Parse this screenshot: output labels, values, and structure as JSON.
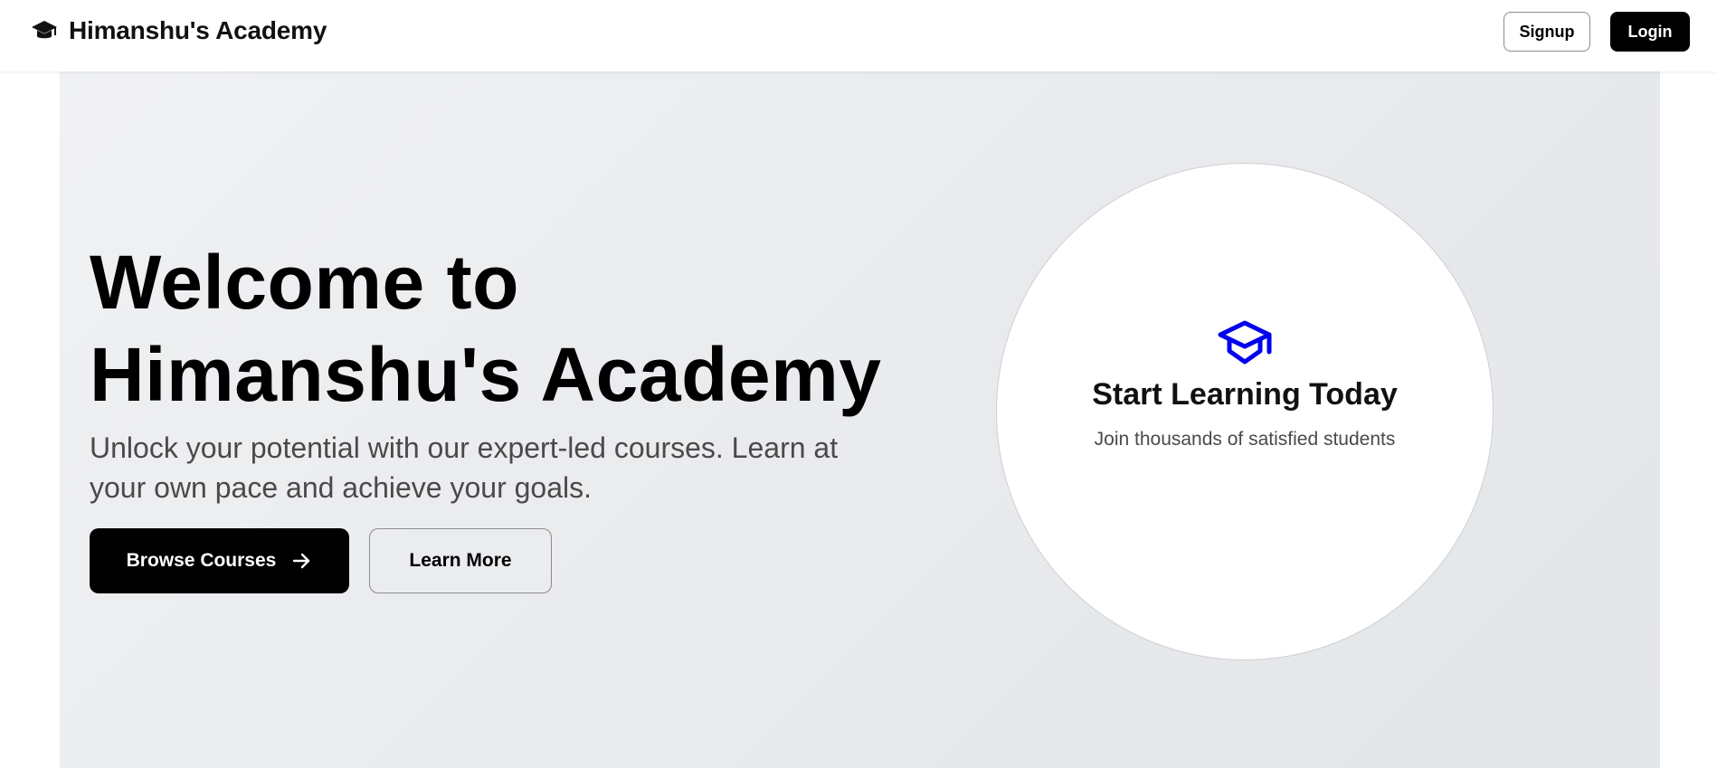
{
  "header": {
    "brand_icon": "graduation-cap-icon",
    "brand_title": "Himanshu's Academy",
    "signup_label": "Signup",
    "login_label": "Login"
  },
  "hero": {
    "title_line1": "Welcome to",
    "title_line2": "Himanshu's Academy",
    "subtitle": "Unlock your potential with our expert-led courses. Learn at your own pace and achieve your goals.",
    "browse_label": "Browse Courses",
    "browse_icon": "arrow-right-icon",
    "learn_more_label": "Learn More"
  },
  "card": {
    "icon": "graduation-cap-icon",
    "icon_color": "#0000ee",
    "title": "Start Learning Today",
    "subtitle": "Join thousands of satisfied students"
  },
  "colors": {
    "primary": "#000000",
    "hero_background": "#e8eaed",
    "accent_icon": "#0000ee"
  }
}
